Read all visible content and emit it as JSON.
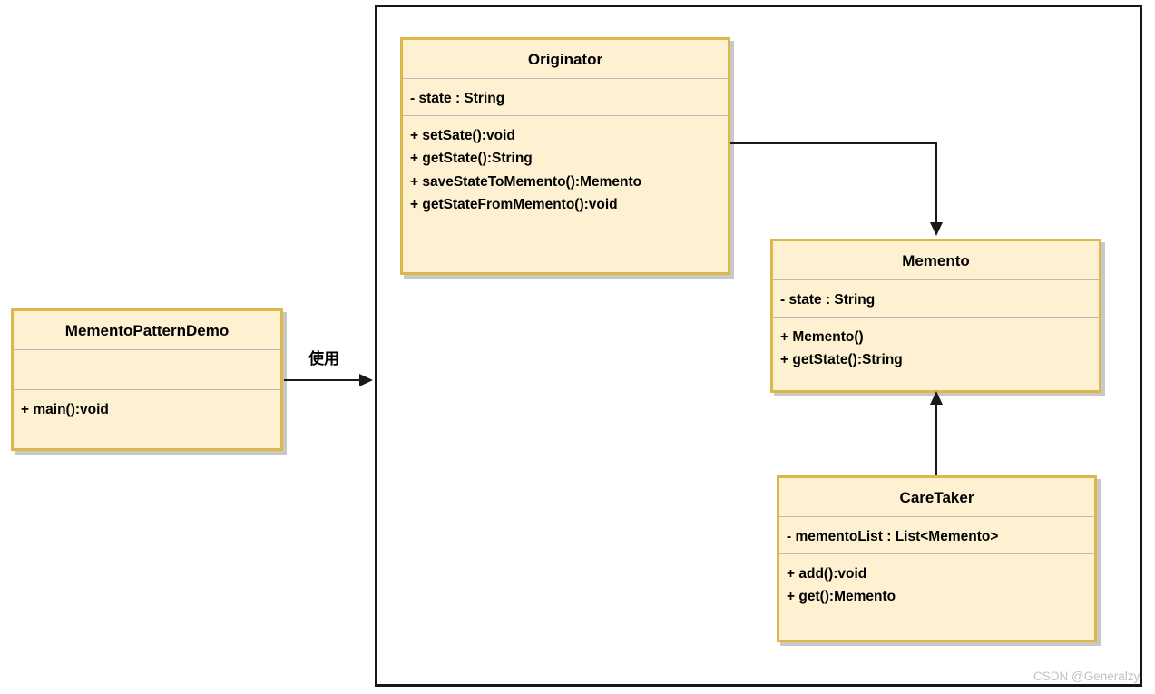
{
  "diagram": {
    "title": "Memento Pattern UML Class Diagram",
    "colors": {
      "class_fill": "#fdf1d1",
      "class_border": "#dcb84b",
      "frame_border": "#161616",
      "separator": "#b9b9b9",
      "connector": "#1a1a1a",
      "watermark": "#c2c2c2"
    }
  },
  "classes": {
    "demo": {
      "name": "MementoPatternDemo",
      "attributes": [],
      "methods": [
        "+ main():void"
      ]
    },
    "originator": {
      "name": "Originator",
      "attributes": [
        "- state : String"
      ],
      "methods": [
        "+ setSate():void",
        "+ getState():String",
        "+ saveStateToMemento():Memento",
        "+ getStateFromMemento():void"
      ]
    },
    "memento": {
      "name": "Memento",
      "attributes": [
        "- state : String"
      ],
      "methods": [
        "+ Memento()",
        "+ getState():String"
      ]
    },
    "caretaker": {
      "name": "CareTaker",
      "attributes": [
        "- mementoList : List<Memento>"
      ],
      "methods": [
        "+ add():void",
        "+ get():Memento"
      ]
    }
  },
  "connectors": {
    "demo_to_package": {
      "label": "使用",
      "arrow": "arrow-right-icon"
    },
    "originator_to_memento": {
      "label": "",
      "arrow": "arrow-down-icon"
    },
    "caretaker_to_memento": {
      "label": "",
      "arrow": "arrow-up-icon"
    }
  },
  "watermark": {
    "text": "CSDN @Generalzy"
  }
}
